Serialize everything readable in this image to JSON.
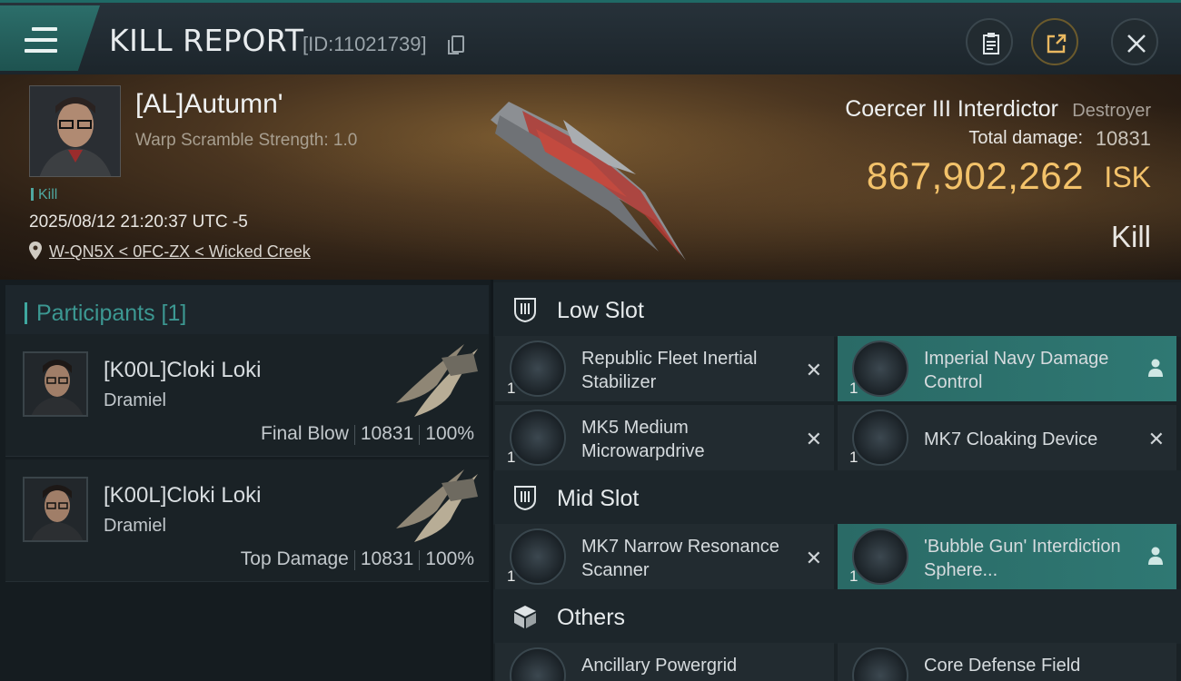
{
  "header": {
    "title": "KILL REPORT",
    "report_id": "[ID:11021739]"
  },
  "victim": {
    "name": "[AL]Autumn'",
    "warp_scramble": "Warp Scramble Strength: 1.0",
    "tag": "Kill",
    "datetime": "2025/08/12 21:20:37 UTC -5",
    "location": "W-QN5X < 0FC-ZX < Wicked Creek",
    "ship_name": "Coercer III Interdictor",
    "ship_class": "Destroyer",
    "damage_label": "Total damage:",
    "damage_value": "10831",
    "isk_value": "867,902,262",
    "isk_unit": "ISK",
    "result": "Kill"
  },
  "participants": {
    "title": "Participants [1]",
    "items": [
      {
        "name": "[K00L]Cloki Loki",
        "ship": "Dramiel",
        "role": "Final Blow",
        "damage": "10831",
        "percent": "100%"
      },
      {
        "name": "[K00L]Cloki Loki",
        "ship": "Dramiel",
        "role": "Top Damage",
        "damage": "10831",
        "percent": "100%"
      }
    ]
  },
  "slots": {
    "low": {
      "label": "Low Slot",
      "modules": [
        {
          "name": "Republic Fleet Inertial Stabilizer",
          "qty": "1",
          "state": "destroyed",
          "icon": "inertial-stabilizer-icon"
        },
        {
          "name": "Imperial Navy Damage Control",
          "qty": "1",
          "state": "dropped",
          "icon": "damage-control-icon"
        },
        {
          "name": "MK5 Medium Microwarpdrive",
          "qty": "1",
          "state": "destroyed",
          "icon": "microwarpdrive-icon"
        },
        {
          "name": "MK7 Cloaking Device",
          "qty": "1",
          "state": "destroyed",
          "icon": "cloaking-device-icon"
        }
      ]
    },
    "mid": {
      "label": "Mid Slot",
      "modules": [
        {
          "name": "MK7 Narrow Resonance Scanner",
          "qty": "1",
          "state": "destroyed",
          "icon": "resonance-scanner-icon"
        },
        {
          "name": "'Bubble Gun' Interdiction Sphere...",
          "qty": "1",
          "state": "dropped",
          "icon": "interdiction-sphere-icon"
        }
      ]
    },
    "others": {
      "label": "Others",
      "modules": [
        {
          "name": "Ancillary Powergrid",
          "qty": "",
          "state": "destroyed",
          "icon": "powergrid-icon"
        },
        {
          "name": "Core Defense Field",
          "qty": "",
          "state": "destroyed",
          "icon": "defense-field-icon"
        }
      ]
    }
  }
}
